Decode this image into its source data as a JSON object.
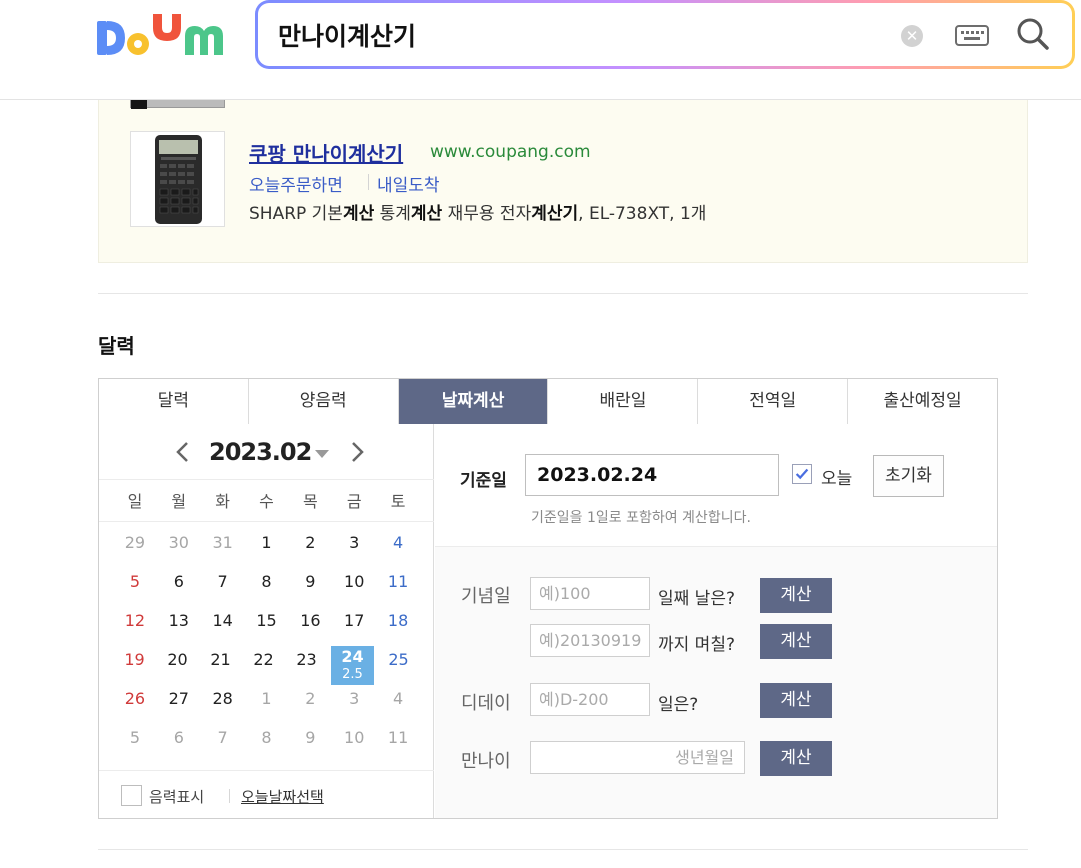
{
  "header": {
    "search_value": "만나이계산기",
    "clear_symbol": "✕"
  },
  "ad": {
    "prev_text": "· ·  ·  · · ·  ·  ·  ·  ·  ·  ·  · ·  ·",
    "title": "쿠팡 만나이계산기",
    "url": "www.coupang.com",
    "tag1": "오늘주문하면",
    "tag2": "내일도착",
    "desc_parts": [
      "SHARP 기본",
      "계산",
      " 통계",
      "계산",
      " 재무용 전자",
      "계산기",
      ", EL-738XT, 1개"
    ]
  },
  "section": {
    "title": "달력"
  },
  "tabs": [
    "달력",
    "양음력",
    "날짜계산",
    "배란일",
    "전역일",
    "출산예정일"
  ],
  "calendar": {
    "month_label": "2023.02",
    "weekdays": [
      "일",
      "월",
      "화",
      "수",
      "목",
      "금",
      "토"
    ],
    "weeks": [
      [
        "29",
        "30",
        "31",
        "1",
        "2",
        "3",
        "4"
      ],
      [
        "5",
        "6",
        "7",
        "8",
        "9",
        "10",
        "11"
      ],
      [
        "12",
        "13",
        "14",
        "15",
        "16",
        "17",
        "18"
      ],
      [
        "19",
        "20",
        "21",
        "22",
        "23",
        "24",
        "25"
      ],
      [
        "26",
        "27",
        "28",
        "1",
        "2",
        "3",
        "4"
      ],
      [
        "5",
        "6",
        "7",
        "8",
        "9",
        "10",
        "11"
      ]
    ],
    "today_sub": "2.5",
    "lunar_label": "음력표시",
    "today_link": "오늘날짜선택"
  },
  "calc": {
    "base_label": "기준일",
    "base_value": "2023.02.24",
    "today_label": "오늘",
    "reset_label": "초기화",
    "base_hint": "기준일을 1일로 포함하여 계산합니다.",
    "anniv_label": "기념일",
    "anniv_placeholder1": "예)100",
    "anniv_suffix1": "일째 날은?",
    "anniv_placeholder2": "예)20130919",
    "anniv_suffix2": "까지 며칠?",
    "dday_label": "디데이",
    "dday_placeholder": "예)D-200",
    "dday_suffix": "일은?",
    "age_label": "만나이",
    "age_placeholder": "생년월일",
    "calc_button": "계산"
  }
}
